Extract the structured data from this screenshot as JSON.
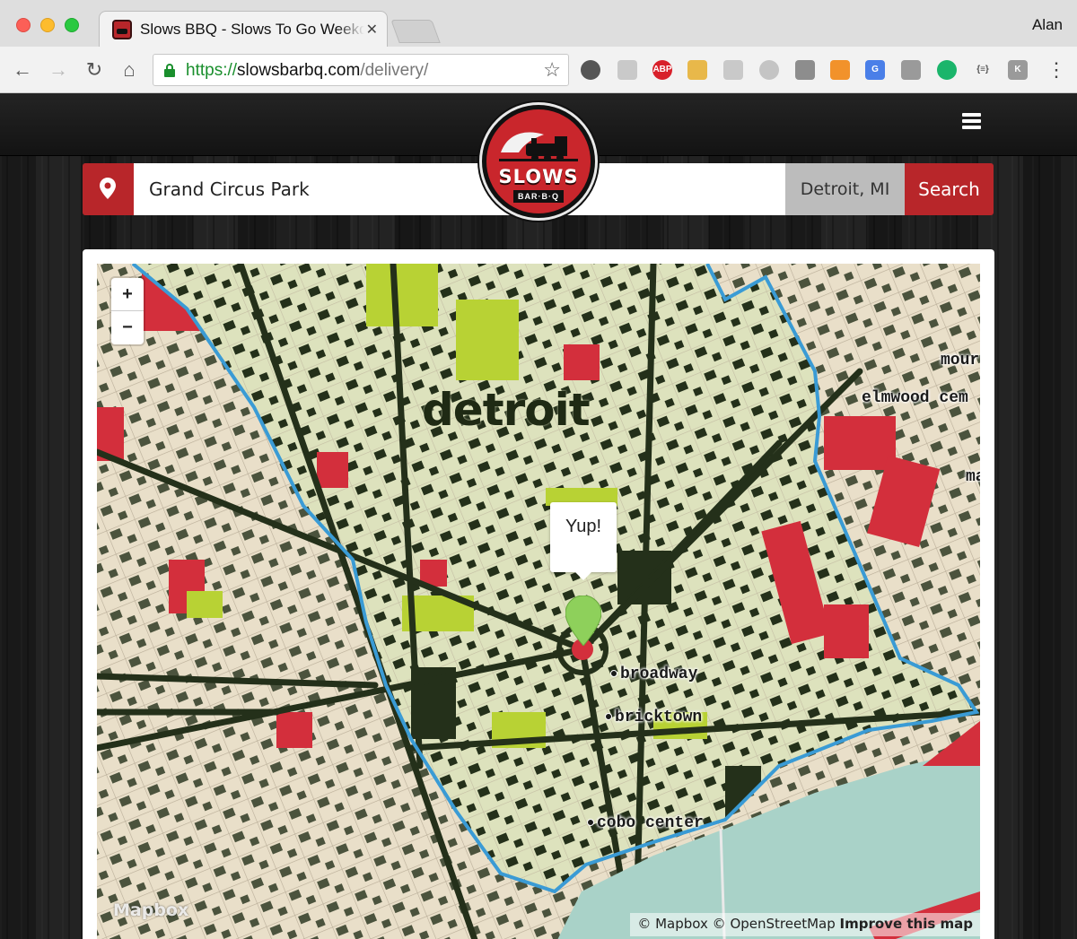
{
  "browser": {
    "tab_title": "Slows BBQ - Slows To Go Weekday Delivery",
    "profile_name": "Alan",
    "url_scheme": "https://",
    "url_host": "slowsbarbq.com",
    "url_path": "/delivery/",
    "extensions": [
      "rocket-icon",
      "shield-icon",
      "adblock-plus-icon",
      "face-icon",
      "screencast-icon",
      "bulb-icon",
      "grid-icon",
      "chart-icon",
      "translate-icon",
      "dropbox-icon",
      "chat-icon",
      "json-icon",
      "k-icon"
    ]
  },
  "site": {
    "logo_text": "SLOWS",
    "logo_subtext": "BAR·B·Q",
    "search": {
      "address_value": "Grand Circus Park",
      "city": "Detroit, MI",
      "button_label": "Search"
    }
  },
  "map": {
    "zoom_in": "+",
    "zoom_out": "−",
    "city_label": "detroit",
    "popup_text": "Yup!",
    "labels": {
      "broadway": "broadway",
      "bricktown": "bricktown",
      "cobo": "cobo center",
      "elmwood": "elmwood cem",
      "mount": "mour",
      "ma": "ma"
    },
    "mapbox_logo": "Mapbox",
    "attribution": {
      "mapbox": "© Mapbox",
      "osm": "© OpenStreetMap",
      "improve": "Improve this map"
    },
    "colors": {
      "land": "#e9dfc9",
      "zone": "#dde2bd",
      "park": "#b8d234",
      "red": "#d32f3c",
      "building": "#24301a",
      "water": "#a9d2c8",
      "boundary": "#3a9bd5",
      "marker": "#8ed05b"
    }
  }
}
